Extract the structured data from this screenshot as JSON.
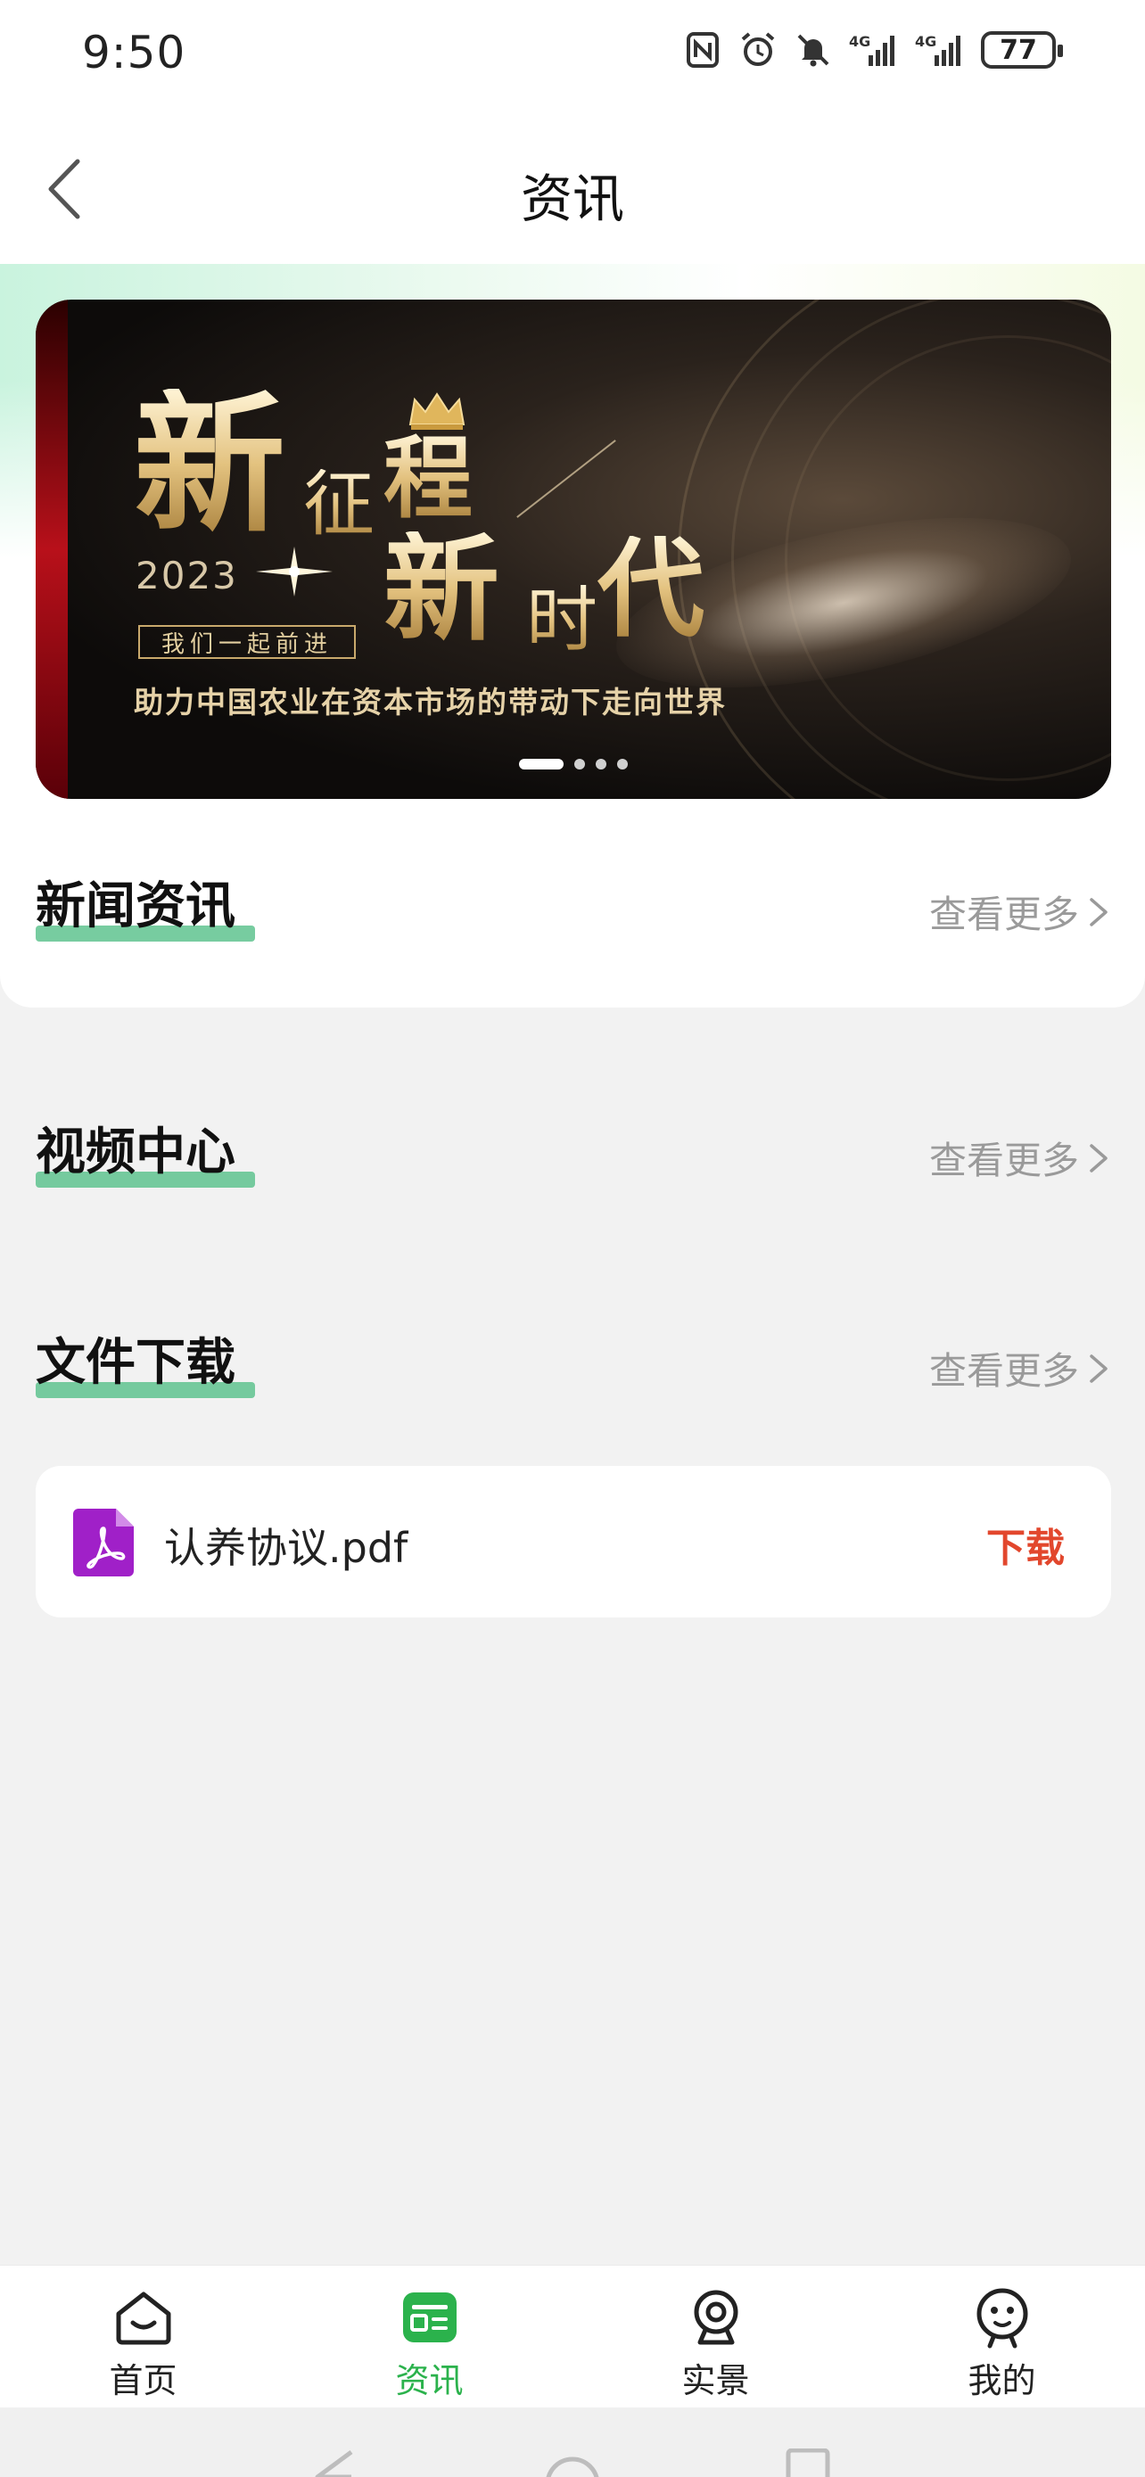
{
  "status_bar": {
    "time": "9:50",
    "battery": "77",
    "network_1": "4G",
    "network_2": "4G"
  },
  "header": {
    "title": "资讯",
    "back_icon": "chevron-left-icon"
  },
  "banner": {
    "headline_1": "新",
    "headline_2": "征",
    "headline_3": "程",
    "headline_4": "新",
    "headline_5": "时",
    "headline_6": "代",
    "year": "2023",
    "tagline": "我们一起前进",
    "slogan": "助力中国农业在资本市场的带动下走向世界",
    "pages": 4,
    "active_page": 1
  },
  "sections": {
    "news": {
      "title": "新闻资讯",
      "more": "查看更多"
    },
    "video": {
      "title": "视频中心",
      "more": "查看更多"
    },
    "files": {
      "title": "文件下载",
      "more": "查看更多"
    }
  },
  "files": [
    {
      "name": "认养协议.pdf",
      "action": "下载",
      "icon": "pdf-icon"
    }
  ],
  "tabbar": {
    "active": "资讯",
    "items": [
      {
        "label": "首页",
        "icon": "home-icon"
      },
      {
        "label": "资讯",
        "icon": "news-icon"
      },
      {
        "label": "实景",
        "icon": "camera-icon"
      },
      {
        "label": "我的",
        "icon": "profile-icon"
      }
    ]
  },
  "colors": {
    "accent_green": "#2bb24c",
    "underline_green": "#5fc38f",
    "download_red": "#e2472d",
    "pdf_purple": "#a020c8"
  }
}
